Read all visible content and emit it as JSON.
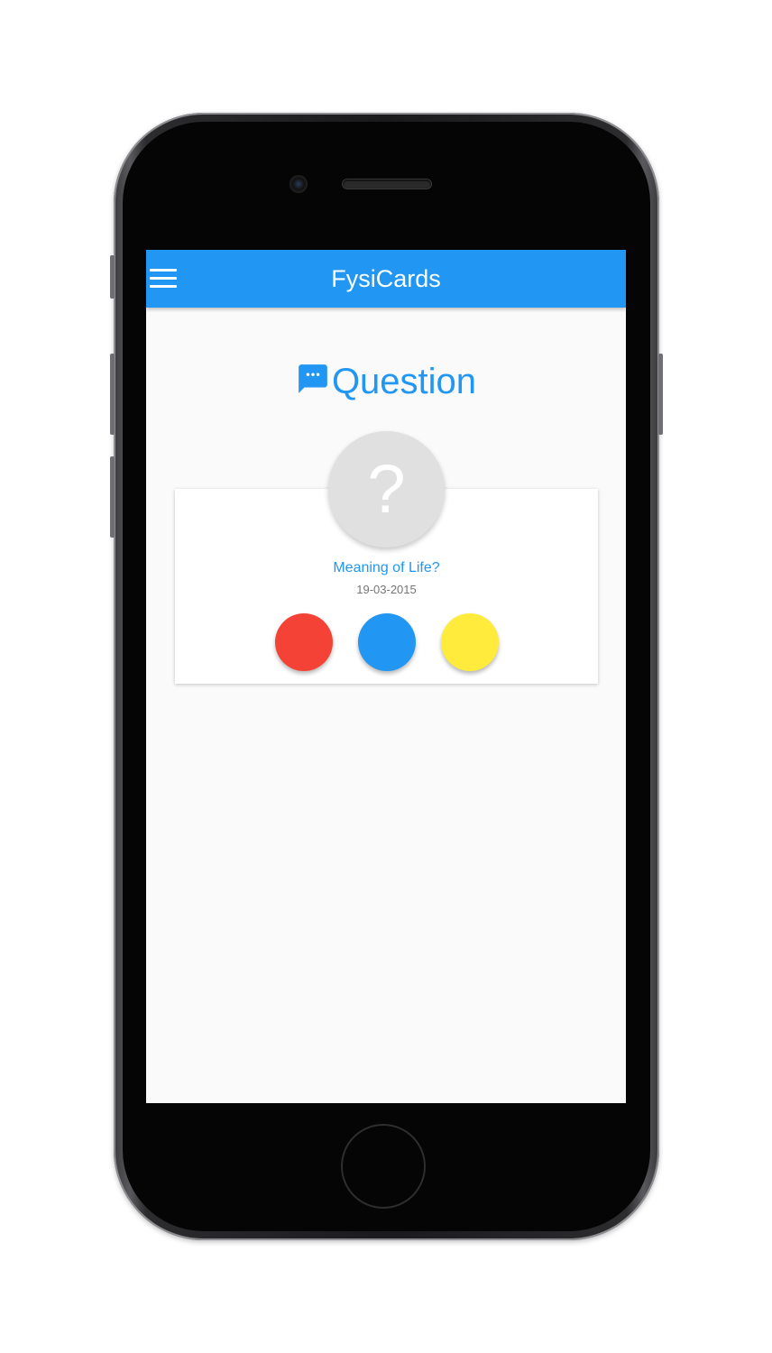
{
  "app": {
    "title": "FysiCards"
  },
  "header": {
    "menu_icon": "hamburger-menu-icon"
  },
  "page": {
    "heading": "Question",
    "heading_icon": "chat-bubble-icon"
  },
  "card": {
    "avatar_symbol": "?",
    "title": "Meaning of Life?",
    "date": "19-03-2015",
    "buttons": [
      {
        "name": "red",
        "color": "#f44336"
      },
      {
        "name": "blue",
        "color": "#2196f3"
      },
      {
        "name": "yellow",
        "color": "#ffeb3b"
      }
    ]
  },
  "colors": {
    "primary": "#2196f3",
    "background": "#fafafa",
    "avatar_bg": "#e0e0e0"
  }
}
